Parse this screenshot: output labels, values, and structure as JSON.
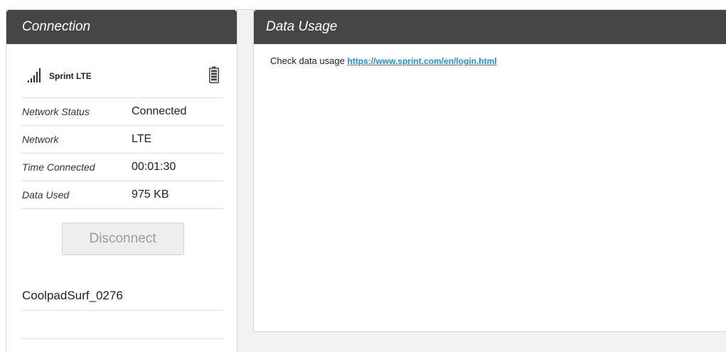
{
  "connection": {
    "title": "Connection",
    "carrier": "Sprint LTE",
    "rows": [
      {
        "label": "Network Status",
        "value": "Connected"
      },
      {
        "label": "Network",
        "value": "LTE"
      },
      {
        "label": "Time Connected",
        "value": "00:01:30"
      },
      {
        "label": "Data Used",
        "value": "975 KB"
      }
    ],
    "disconnect_label": "Disconnect",
    "ssid": "CoolpadSurf_0276"
  },
  "data_usage": {
    "title": "Data Usage",
    "text": "Check data usage",
    "link": "https://www.sprint.com/en/login.html"
  },
  "colors": {
    "header_bg": "#464646",
    "link": "#1a8fd6",
    "disabled_text": "#9c9c9c"
  },
  "icons": {
    "signal": "signal-bars-icon",
    "battery": "battery-icon"
  }
}
